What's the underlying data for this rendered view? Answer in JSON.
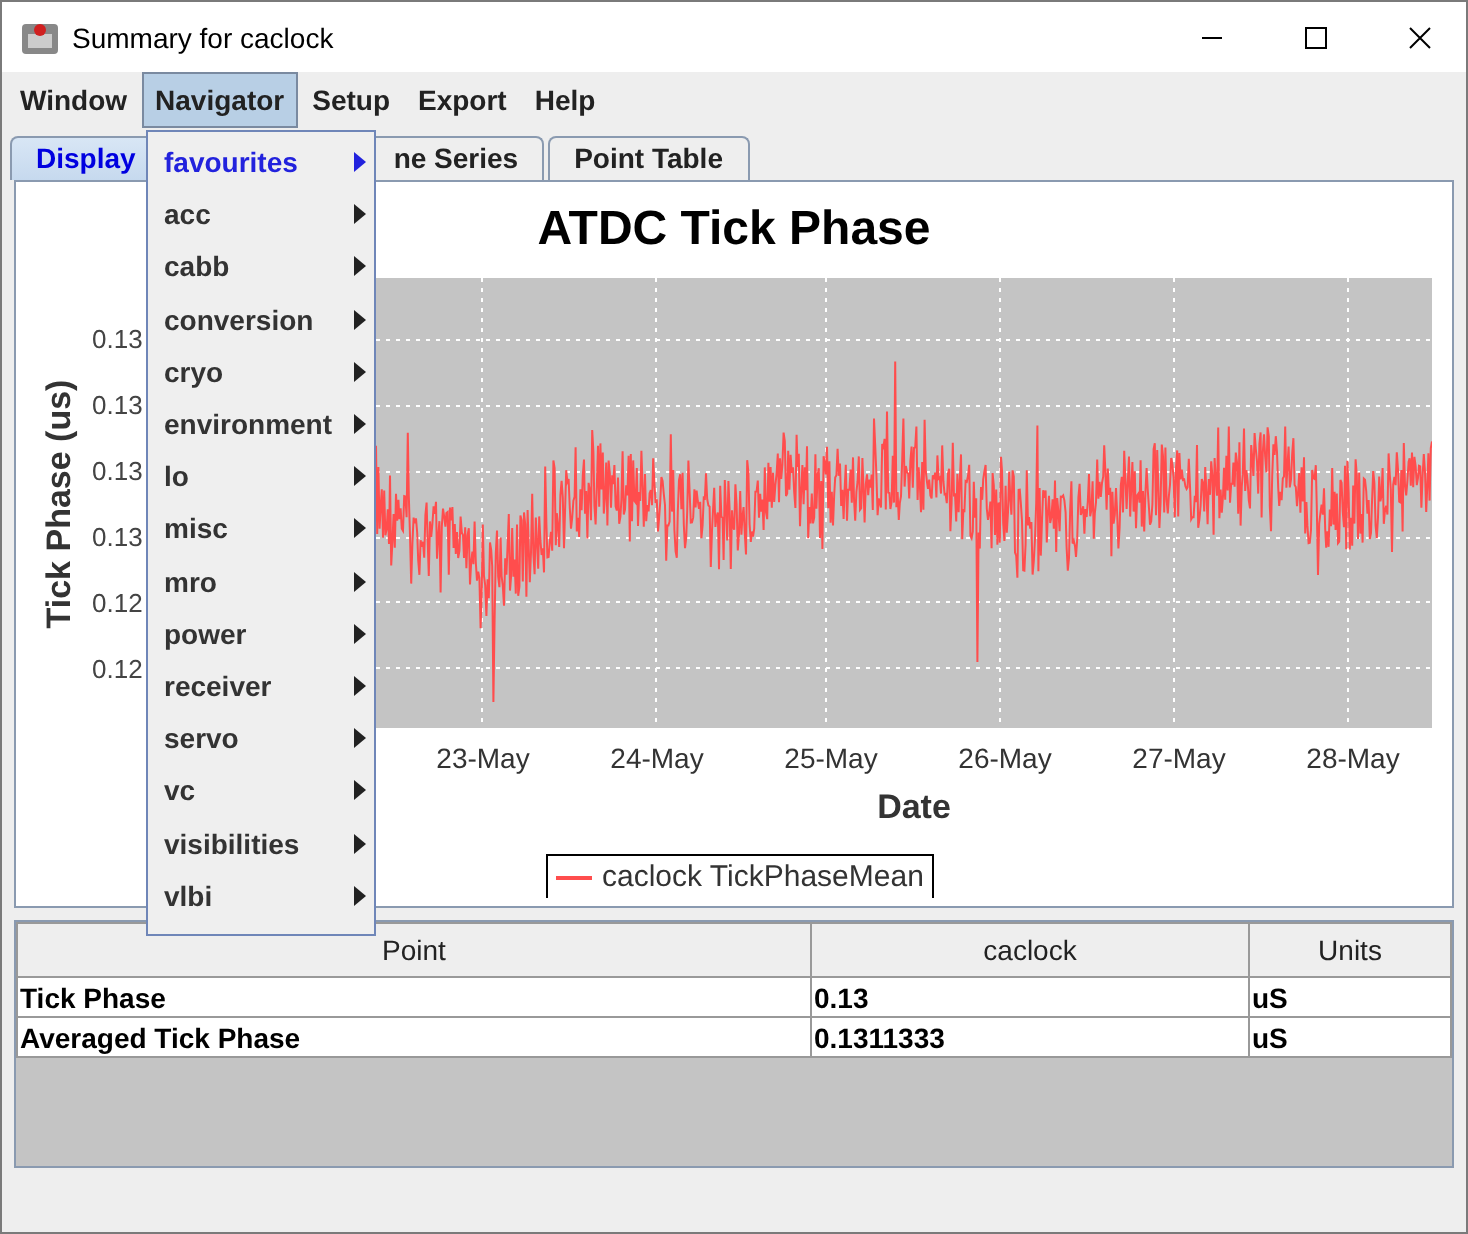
{
  "window": {
    "title": "Summary for caclock"
  },
  "menubar": [
    {
      "label": "Window",
      "selected": false
    },
    {
      "label": "Navigator",
      "selected": true
    },
    {
      "label": "Setup",
      "selected": false
    },
    {
      "label": "Export",
      "selected": false
    },
    {
      "label": "Help",
      "selected": false
    }
  ],
  "navigator_menu": [
    {
      "label": "favourites",
      "selected": true
    },
    {
      "label": "acc",
      "selected": false
    },
    {
      "label": "cabb",
      "selected": false
    },
    {
      "label": "conversion",
      "selected": false
    },
    {
      "label": "cryo",
      "selected": false
    },
    {
      "label": "environment",
      "selected": false
    },
    {
      "label": "lo",
      "selected": false
    },
    {
      "label": "misc",
      "selected": false
    },
    {
      "label": "mro",
      "selected": false
    },
    {
      "label": "power",
      "selected": false
    },
    {
      "label": "receiver",
      "selected": false
    },
    {
      "label": "servo",
      "selected": false
    },
    {
      "label": "vc",
      "selected": false
    },
    {
      "label": "visibilities",
      "selected": false
    },
    {
      "label": "vlbi",
      "selected": false
    }
  ],
  "tabs": [
    {
      "label": "Display",
      "selected": true
    },
    {
      "label": "ne Series",
      "selected": false
    },
    {
      "label": "Point Table",
      "selected": false
    }
  ],
  "chart": {
    "title": "ATDC Tick Phase",
    "ylabel": "Tick Phase (us)",
    "yticks": [
      "0.13",
      "0.13",
      "0.13",
      "0.13",
      "0.12",
      "0.12"
    ],
    "xticks": [
      "23-May",
      "24-May",
      "25-May",
      "26-May",
      "27-May",
      "28-May"
    ],
    "xlabel": "Date",
    "legend": "caclock TickPhaseMean"
  },
  "table": {
    "columns": [
      "Point",
      "caclock",
      "Units"
    ],
    "rows": [
      [
        "Tick Phase",
        "0.13",
        "uS"
      ],
      [
        "Averaged Tick Phase",
        "0.1311333",
        "uS"
      ]
    ]
  }
}
